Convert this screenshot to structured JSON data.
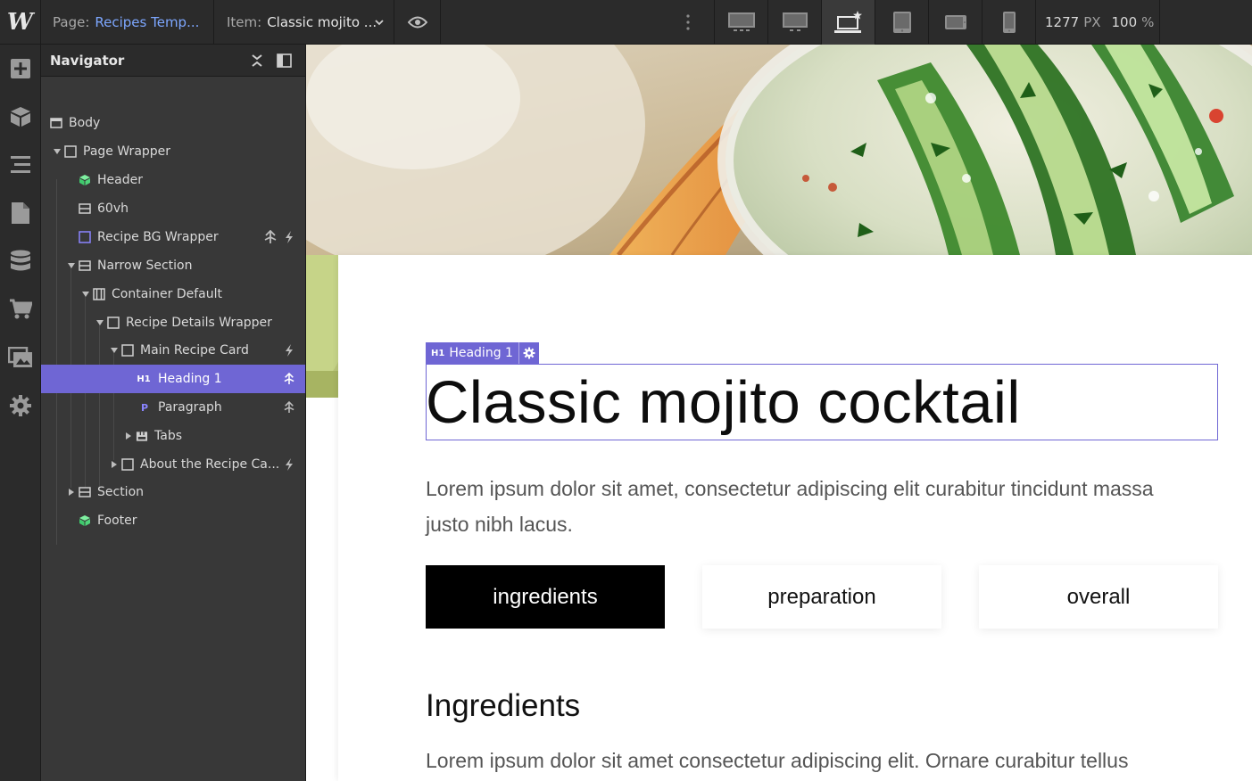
{
  "topbar": {
    "logo": "W",
    "page_label": "Page:",
    "page_value": "Recipes Temp...",
    "item_label": "Item:",
    "item_value": "Classic mojito ...",
    "width_value": "1277",
    "width_unit": "PX",
    "zoom_value": "100",
    "zoom_unit": "%"
  },
  "navigator": {
    "title": "Navigator",
    "nodes": [
      {
        "label": "Body",
        "icon": "body-icon"
      },
      {
        "label": "Page Wrapper",
        "icon": "box-icon"
      },
      {
        "label": "Header",
        "icon": "symbol-icon"
      },
      {
        "label": "60vh",
        "icon": "section-icon"
      },
      {
        "label": "Recipe BG Wrapper",
        "icon": "box-icon"
      },
      {
        "label": "Narrow Section",
        "icon": "section-icon"
      },
      {
        "label": "Container Default",
        "icon": "container-icon"
      },
      {
        "label": "Recipe Details Wrapper",
        "icon": "box-icon"
      },
      {
        "label": "Main Recipe Card",
        "icon": "box-icon"
      },
      {
        "label": "Heading 1",
        "icon": "h1-icon",
        "icon_text": "H1"
      },
      {
        "label": "Paragraph",
        "icon": "paragraph-icon",
        "icon_text": "P"
      },
      {
        "label": "Tabs",
        "icon": "tabs-icon"
      },
      {
        "label": "About the Recipe Ca...",
        "icon": "box-icon"
      },
      {
        "label": "Section",
        "icon": "section-icon"
      },
      {
        "label": "Footer",
        "icon": "symbol-icon"
      }
    ]
  },
  "canvas": {
    "selection_tag_prefix": "H1",
    "selection_tag_label": "Heading 1",
    "heading": "Classic mojito cocktail",
    "paragraph": "Lorem ipsum dolor sit amet, consectetur adipiscing elit curabitur tincidunt massa justo nibh lacus.",
    "tabs": [
      "ingredients",
      "preparation",
      "overall"
    ],
    "subheading": "Ingredients",
    "paragraph2": "Lorem ipsum dolor sit amet consectetur adipiscing elit. Ornare curabitur tellus"
  },
  "colors": {
    "accent": "#6f66d4",
    "link": "#7da7ff",
    "symbol": "#4fd47a"
  }
}
